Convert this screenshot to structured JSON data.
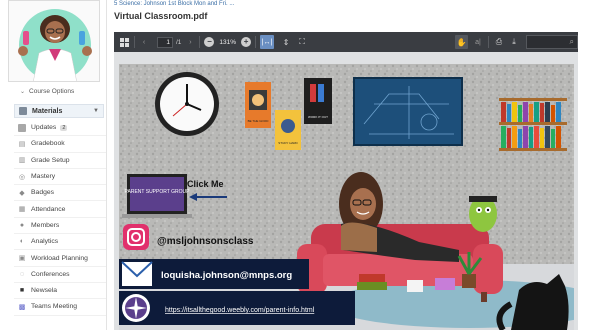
{
  "breadcrumb": "5 Science: Johnson 1st Block Mon and Fri. ...",
  "document_title": "Virtual Classroom.pdf",
  "sidebar": {
    "course_options": "Course Options",
    "materials": "Materials",
    "items": [
      {
        "label": "Updates",
        "badge": "2",
        "icon": "updates-icon"
      },
      {
        "label": "Gradebook",
        "icon": "gradebook-icon"
      },
      {
        "label": "Grade Setup",
        "icon": "grade-setup-icon"
      },
      {
        "label": "Mastery",
        "icon": "mastery-icon"
      },
      {
        "label": "Badges",
        "icon": "badge-icon"
      },
      {
        "label": "Attendance",
        "icon": "attendance-icon"
      },
      {
        "label": "Members",
        "icon": "members-icon"
      },
      {
        "label": "Analytics",
        "icon": "analytics-icon"
      },
      {
        "label": "Workload Planning",
        "icon": "workload-icon"
      },
      {
        "label": "Conferences",
        "icon": "conferences-icon"
      },
      {
        "label": "Newsela",
        "icon": "newsela-icon"
      },
      {
        "label": "Teams Meeting",
        "icon": "teams-icon"
      }
    ]
  },
  "toolbar": {
    "page_current": "1",
    "page_total": "/1",
    "zoom": "131%"
  },
  "classroom": {
    "parent_support": "PARENT SUPPORT GROUP",
    "click_me": "Click Me",
    "instagram": "@msljohnsonsclass",
    "email": "loquisha.johnson@mnps.org",
    "website": "https://itsallthegood.weebly.com/parent-info.html",
    "poster1_text": "BE THE GOOD",
    "poster2_text": "WORK IT OUT",
    "poster3_text": "STUDY HARD"
  },
  "colors": {
    "toolbar": "#3a3d42",
    "accent_link": "#3a6ea5",
    "couch": "#d9495a"
  }
}
